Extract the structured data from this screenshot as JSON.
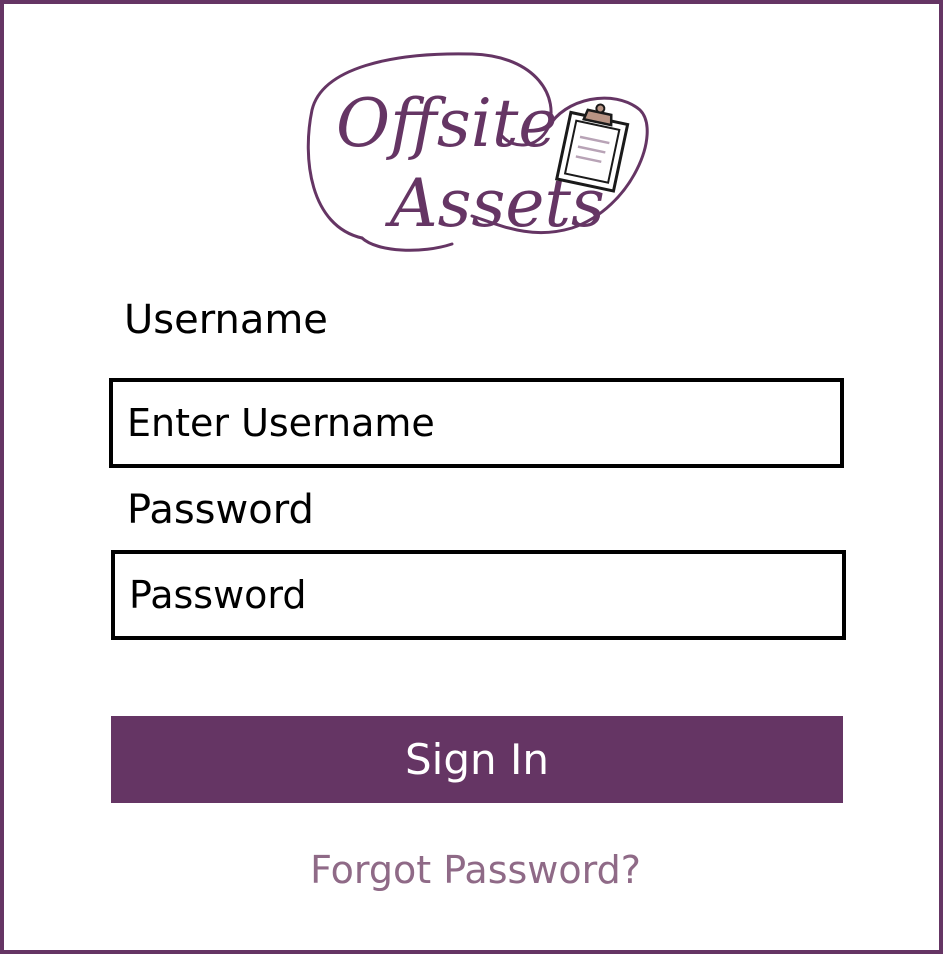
{
  "brand": {
    "name_line1": "Offsite",
    "name_line2": "Assets",
    "icon": "clipboard-icon",
    "accent_color": "#653564"
  },
  "form": {
    "username_label": "Username",
    "username_placeholder": "Enter Username",
    "password_label": "Password",
    "password_placeholder": "Password",
    "submit_label": "Sign In",
    "forgot_label": "Forgot Password?"
  },
  "colors": {
    "primary": "#653564",
    "link": "#8f6a87",
    "text": "#000000",
    "background": "#ffffff"
  }
}
